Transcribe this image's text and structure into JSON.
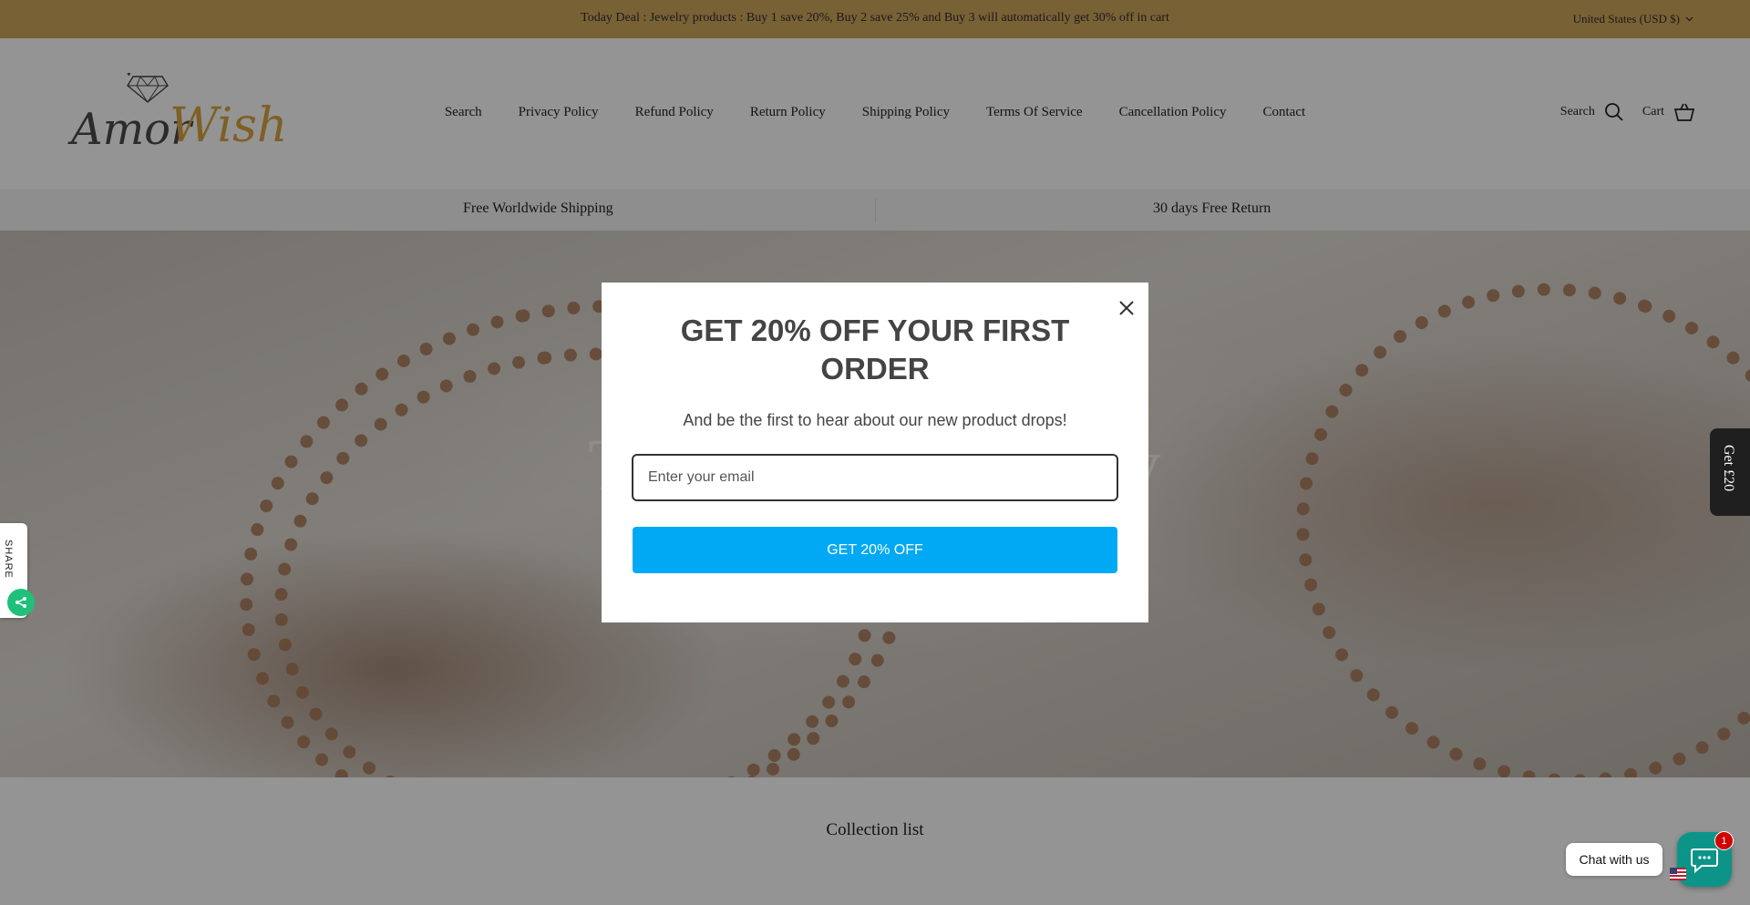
{
  "announcement": {
    "message": "Today Deal : Jewelry products : Buy 1 save 20%, Buy 2 save 25% and Buy 3 will automatically get 30% off in cart",
    "currency": "United States (USD $)"
  },
  "logo": {
    "part1": "Amor",
    "part2": "Wish"
  },
  "nav": [
    "Search",
    "Privacy Policy",
    "Refund Policy",
    "Return Policy",
    "Shipping Policy",
    "Terms Of Service",
    "Cancellation Policy",
    "Contact"
  ],
  "header_actions": {
    "search_label": "Search",
    "cart_label": "Cart"
  },
  "usp": {
    "left": "Free Worldwide Shipping",
    "right": "30 days Free Return"
  },
  "hero": {
    "title": "The Joy of Luxury"
  },
  "collection": {
    "title": "Collection list"
  },
  "widgets": {
    "share_label": "SHARE",
    "reward_label": "Get £20",
    "chat_label": "Chat with us",
    "chat_badge": "1"
  },
  "popup": {
    "headline": "GET 20% OFF YOUR FIRST ORDER",
    "subtext": "And be the first to hear about our new product drops!",
    "email_placeholder": "Enter your email",
    "submit_label": "GET 20% OFF"
  },
  "colors": {
    "announcement_bg": "#d1a85e",
    "popup_button": "#01a9f4",
    "chat_button": "#0d9488",
    "share_button": "#1fc07a",
    "logo_gold": "#d9a441"
  },
  "icons": {
    "currency": "chevron-down-icon",
    "search": "search-icon",
    "cart": "cart-icon",
    "close": "close-icon",
    "share": "share-icon",
    "chat": "chat-icon"
  }
}
